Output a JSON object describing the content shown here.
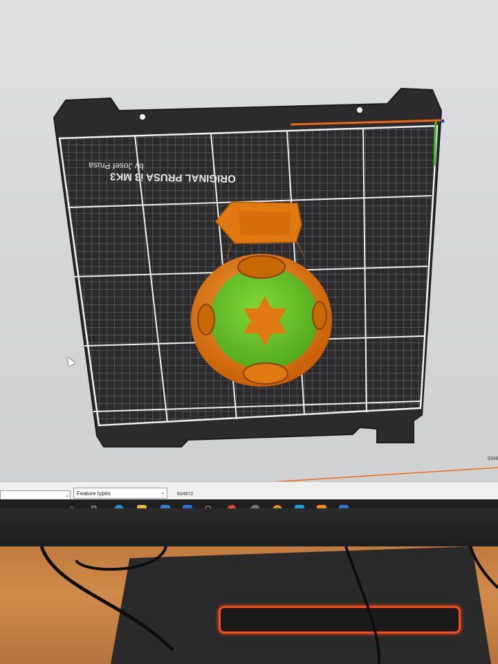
{
  "bed": {
    "brand_line": "ORIGINAL PRUSA i3 MK3",
    "author_line": "by Josef Prusa"
  },
  "status_bar": {
    "feature_types_label": "Feature types",
    "layer_value": "634872",
    "right_value": "6349"
  },
  "taskbar": {
    "icons": [
      "windows-start-icon",
      "task-view-icon",
      "edge-icon",
      "file-explorer-icon",
      "store-icon",
      "mail-icon",
      "cube-icon",
      "chrome-icon",
      "chrome-icon",
      "cura-icon",
      "prusaslicer-icon",
      "photos-icon"
    ]
  },
  "colors": {
    "bed": "#2b2b2e",
    "grid": "#e6e6e6",
    "print_orange": "#e07a10",
    "print_green": "#6cc52a",
    "slider_orange": "#ee6a10",
    "stand_light": "#ff4a1c"
  }
}
